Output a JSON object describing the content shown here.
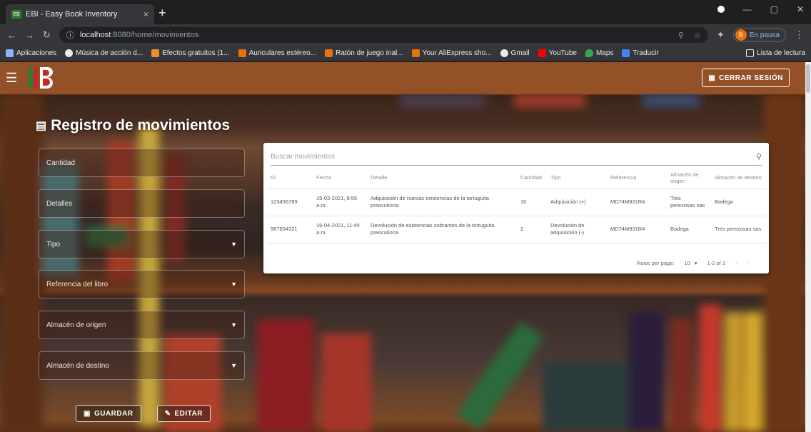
{
  "browser": {
    "tab_title": "EBI - Easy Book Inventory",
    "tab_close": "×",
    "new_tab": "+",
    "url_host": "localhost",
    "url_path": ":8080/home/movimientos",
    "profile_label": "En pausa",
    "profile_initial": "B"
  },
  "bookmarks": {
    "items": [
      {
        "label": "Aplicaciones",
        "color": "#8ab4f8"
      },
      {
        "label": "Música de acción d...",
        "color": "#e8eaed"
      },
      {
        "label": "Efectos gratuitos (1...",
        "color": "#f28b30"
      },
      {
        "label": "Auriculares estéreo...",
        "color": "#e8710a"
      },
      {
        "label": "Ratón de juego inal...",
        "color": "#e8710a"
      },
      {
        "label": "Your AliExpress sho...",
        "color": "#e8710a"
      },
      {
        "label": "Gmail",
        "color": "#e8eaed"
      },
      {
        "label": "YouTube",
        "color": "#ff0000"
      },
      {
        "label": "Maps",
        "color": "#34a853"
      },
      {
        "label": "Traducir",
        "color": "#4285f4"
      }
    ],
    "reading_list": "Lista de lectura"
  },
  "app": {
    "logout_label": "CERRAR SESIÓN",
    "page_title": "Registro de movimientos",
    "fields": [
      {
        "label": "Cantidad",
        "has_arrow": false
      },
      {
        "label": "Detalles",
        "has_arrow": false
      },
      {
        "label": "Tipo",
        "has_arrow": true
      },
      {
        "label": "Referencia del libro",
        "has_arrow": true
      },
      {
        "label": "Almacén de origen",
        "has_arrow": true
      },
      {
        "label": "Almacén de destino",
        "has_arrow": true
      }
    ],
    "save_label": "GUARDAR",
    "edit_label": "EDITAR"
  },
  "table": {
    "search_placeholder": "Buscar movimientos",
    "columns": [
      "ID",
      "Fecha",
      "Detalle",
      "Cantidad",
      "Tipo",
      "Referencia",
      "Almacén de origen",
      "Almacén de destino"
    ],
    "rows": [
      [
        "123456789",
        "15-03-2021, 8:55 a.m.",
        "Adquisición de nuevas existencias de la tortuguita preocutiona",
        "10",
        "Adquisición (+)",
        "MD74M931R4",
        "Tres perezosas sas",
        "Bodega"
      ],
      [
        "987654321",
        "16-04-2021, 11:40 a.m.",
        "Devolución de existencias sobrantes de la tortuguita preocutiona",
        "2",
        "Devolución de adquisición (-)",
        "MD74M931R4",
        "Bodega",
        "Tres perezosas sas"
      ]
    ],
    "rows_per_page_label": "Rows per page:",
    "rows_per_page_value": "10",
    "range_label": "1-2 of 2"
  }
}
